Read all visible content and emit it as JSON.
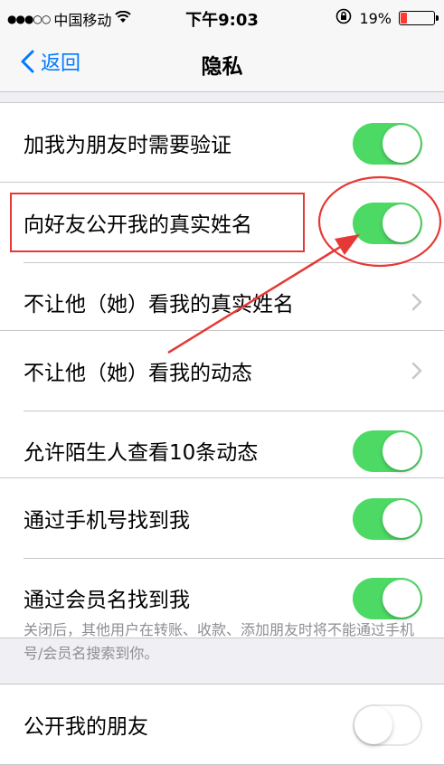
{
  "status_bar": {
    "signal": "●●●○○",
    "carrier": "中国移动",
    "wifi_icon": "wifi-icon",
    "time": "下午9:03",
    "orientation_lock_icon": "lock-rotation-icon",
    "battery_percent": "19%",
    "battery_level": 0.19,
    "battery_color": "#ff3b30"
  },
  "nav": {
    "back_label": "返回",
    "title": "隐私"
  },
  "groups": [
    {
      "rows": [
        {
          "label": "加我为朋友时需要验证",
          "control": "toggle",
          "on": true
        }
      ]
    },
    {
      "rows": [
        {
          "label": "向好友公开我的真实姓名",
          "control": "toggle",
          "on": true
        },
        {
          "label": "不让他（她）看我的真实姓名",
          "control": "chevron"
        }
      ]
    },
    {
      "rows": [
        {
          "label": "不让他（她）看我的动态",
          "control": "chevron"
        },
        {
          "label": "允许陌生人查看10条动态",
          "control": "toggle",
          "on": true
        }
      ]
    },
    {
      "rows": [
        {
          "label": "通过手机号找到我",
          "control": "toggle",
          "on": true
        },
        {
          "label": "通过会员名找到我",
          "control": "toggle",
          "on": true
        }
      ]
    },
    {
      "rows": [
        {
          "label": "公开我的朋友",
          "control": "toggle",
          "on": false
        }
      ]
    }
  ],
  "footer_note": "关闭后，其他用户在转账、收款、添加朋友时将不能通过手机号/会员名搜索到你。",
  "colors": {
    "accent": "#007aff",
    "toggle_on": "#4cd964",
    "annotation": "#e53935"
  }
}
